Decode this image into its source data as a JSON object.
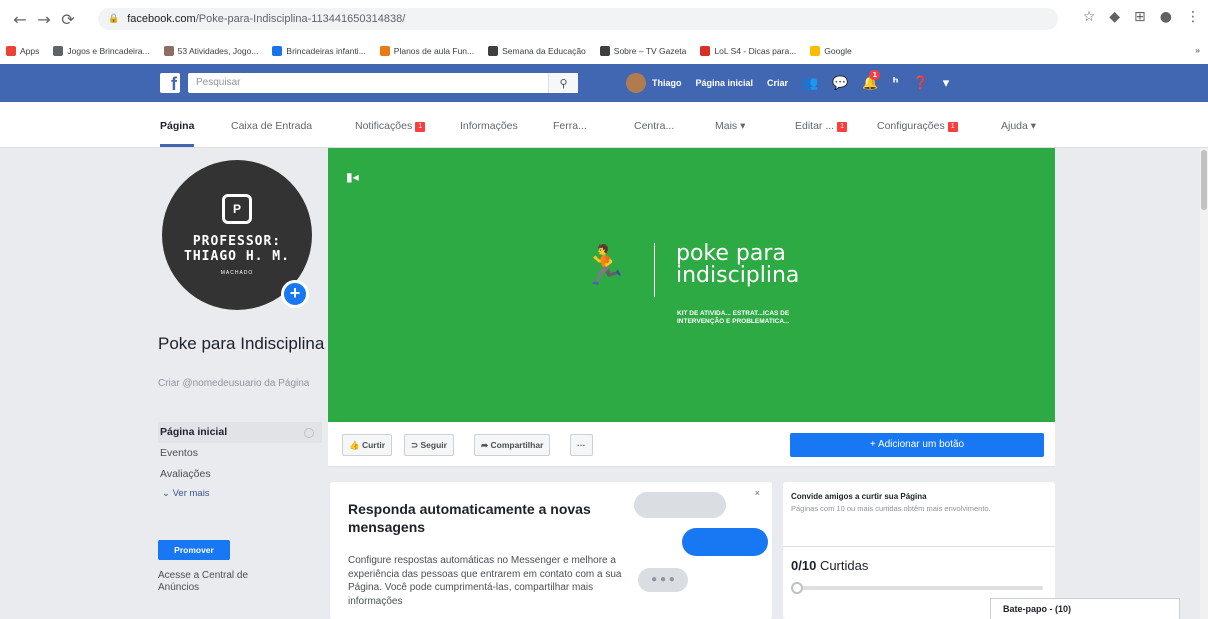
{
  "browser": {
    "url_host": "facebook.com",
    "url_path": "/Poke-para-Indisciplina-113441650314838/",
    "bookmarks": [
      {
        "label": "Apps",
        "color": "#ea4335"
      },
      {
        "label": "Jogos e Brincadeira...",
        "color": "#5f6368"
      },
      {
        "label": "53 Atividades, Jogo...",
        "color": "#8d6e63"
      },
      {
        "label": "Brincadeiras infanti...",
        "color": "#1a73e8"
      },
      {
        "label": "Planos de aula Fun...",
        "color": "#e67c13"
      },
      {
        "label": "Semana da Educação",
        "color": "#3c4043"
      },
      {
        "label": "Sobre – TV Gazeta",
        "color": "#3c4043"
      },
      {
        "label": "LoL S4 - Dicas para...",
        "color": "#d93025"
      },
      {
        "label": "Google",
        "color": "#fbbc04"
      }
    ],
    "more_bookmarks": "»"
  },
  "fb": {
    "search_placeholder": "Pesquisar",
    "user_name": "Thiago",
    "home_label": "Página inicial",
    "create_label": "Criar",
    "notif_count": "1"
  },
  "tabs": [
    {
      "label": "Página",
      "active": true,
      "badge": ""
    },
    {
      "label": "Caixa de Entrada",
      "badge": ""
    },
    {
      "label": "Notificações",
      "badge": "1"
    },
    {
      "label": "Informações",
      "badge": ""
    },
    {
      "label": "Ferra...",
      "badge": ""
    },
    {
      "label": "Centra...",
      "badge": ""
    },
    {
      "label": "Mais ▾",
      "badge": ""
    },
    {
      "label": "Editar ...",
      "badge": "1"
    },
    {
      "label": "Configurações",
      "badge": "1"
    },
    {
      "label": "Ajuda ▾",
      "badge": ""
    }
  ],
  "profile": {
    "logo_letter": "P",
    "logo_line1": "PROFESSOR:",
    "logo_line2": "THIAGO H. M.",
    "logo_line3": "MACHADO"
  },
  "page": {
    "name": "Poke para Indisciplina",
    "username_link": "Criar @nomedeusuario da Página"
  },
  "leftnav": {
    "items": [
      "Página inicial",
      "Eventos",
      "Avaliações"
    ],
    "more": "⌄ Ver mais",
    "promote": "Promover",
    "ads_center": "Acesse a Central de Anúncios"
  },
  "cover": {
    "title_line1": "poke para",
    "title_line2": "indisciplina",
    "subtitle": "KIT DE ATIVIDA... ESTRAT...ICAS DE INTERVENÇÃO E PROBLEMATICA...",
    "accent_color": "#2eaa45"
  },
  "actions": {
    "like": "Curtir",
    "follow": "Seguir",
    "share": "Compartilhar",
    "more": "···",
    "add_button": "+ Adicionar um botão"
  },
  "messenger_card": {
    "title": "Responda automaticamente a novas mensagens",
    "body": "Configure respostas automáticas no Messenger e melhore a experiência das pessoas que entrarem em contato com a sua Página. Você pode cumprimentá-las, compartilhar mais informações",
    "close": "×"
  },
  "invite_card": {
    "title": "Convide amigos a curtir sua Página",
    "subtitle": "Páginas com 10 ou mais curtidas obtêm mais envolvimento.",
    "likes_value": "0/10",
    "likes_label": "Curtidas",
    "progress": 0
  },
  "chat": {
    "label": "Bate-papo - (10)"
  }
}
